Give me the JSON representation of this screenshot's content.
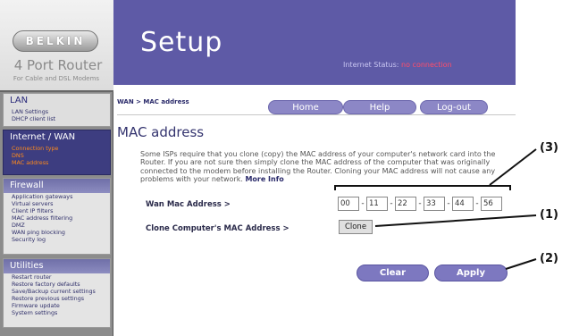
{
  "brand": {
    "logo_text": "BELKIN",
    "product": "4 Port Router",
    "tagline": "For Cable and DSL Modems"
  },
  "sidebar": {
    "sections": [
      {
        "title": "LAN",
        "items": [
          "LAN Settings",
          "DHCP client list"
        ]
      },
      {
        "title": "Internet / WAN",
        "items": [
          "Connection type",
          "DNS",
          "MAC address"
        ]
      },
      {
        "title": "Firewall",
        "items": [
          "Application gateways",
          "Virtual servers",
          "Client IP filters",
          "MAC address filtering",
          "DMZ",
          "WAN ping blocking",
          "Security log"
        ]
      },
      {
        "title": "Utilities",
        "items": [
          "Restart router",
          "Restore factory defaults",
          "Save/Backup current settings",
          "Restore previous settings",
          "Firmware update",
          "System settings"
        ]
      }
    ],
    "active_item": "MAC address"
  },
  "header": {
    "title": "Setup",
    "status_label": "Internet Status:",
    "status_value": "no connection"
  },
  "breadcrumb": "WAN > MAC address",
  "topnav": {
    "home": "Home",
    "help": "Help",
    "logout": "Log-out"
  },
  "main": {
    "title": "MAC address",
    "description": "Some ISPs require that you clone (copy) the MAC address of your computer's network card into the Router. If you are not sure then simply clone the MAC address of the computer that was originally connected to the modem before installing the Router. Cloning your MAC address will not cause any problems with your network.",
    "more_info": "More Info",
    "wan_mac_label": "Wan Mac Address >",
    "mac_octets": [
      "00",
      "11",
      "22",
      "33",
      "44",
      "56"
    ],
    "mac_separator": "-",
    "clone_label": "Clone Computer's MAC Address >",
    "clone_button": "Clone",
    "clear_button": "Clear changes",
    "apply_button": "Apply changes"
  },
  "callouts": {
    "c1": "(1)",
    "c2": "(2)",
    "c3": "(3)"
  },
  "colors": {
    "header_bg": "#5e5aa6",
    "active_nav": "#3d3d80",
    "active_link": "#ff8a1a",
    "status_value": "#ff4d6a",
    "button": "#7d78c0"
  }
}
